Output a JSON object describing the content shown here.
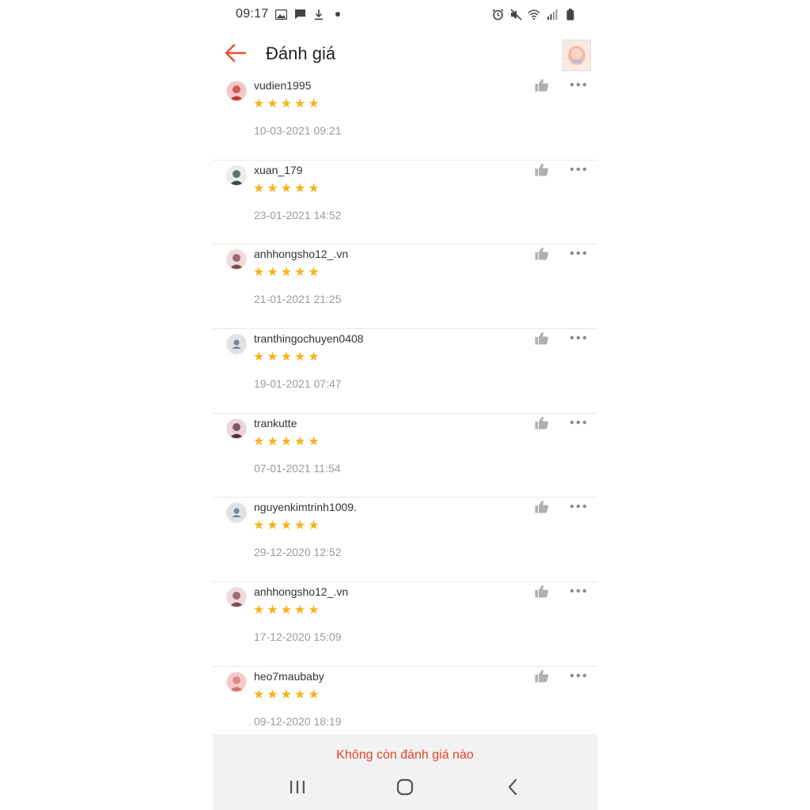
{
  "status_bar": {
    "time": "09:17",
    "left_icons": [
      "image-icon",
      "message-icon",
      "download-icon",
      "dot-icon"
    ],
    "right_icons": [
      "alarm-icon",
      "mute-icon",
      "wifi-icon",
      "signal-icon",
      "battery-icon"
    ]
  },
  "header": {
    "title": "Đánh giá",
    "back_icon": "arrow-left-icon",
    "accent_color": "#ee4d2d"
  },
  "reviews": [
    {
      "username": "vudien1995",
      "rating": 5,
      "date": "10-03-2021 09:21",
      "avatar": "photo"
    },
    {
      "username": "xuan_179",
      "rating": 5,
      "date": "23-01-2021 14:52",
      "avatar": "photo"
    },
    {
      "username": "anhhongsho12_.vn",
      "rating": 5,
      "date": "21-01-2021 21:25",
      "avatar": "photo"
    },
    {
      "username": "tranthingochuyen0408",
      "rating": 5,
      "date": "19-01-2021 07:47",
      "avatar": "default"
    },
    {
      "username": "trankutte",
      "rating": 5,
      "date": "07-01-2021 11:54",
      "avatar": "photo"
    },
    {
      "username": "nguyenkimtrinh1009.",
      "rating": 5,
      "date": "29-12-2020 12:52",
      "avatar": "default"
    },
    {
      "username": "anhhongsho12_.vn",
      "rating": 5,
      "date": "17-12-2020 15:09",
      "avatar": "photo"
    },
    {
      "username": "heo7maubaby",
      "rating": 5,
      "date": "09-12-2020 18:19",
      "avatar": "photo"
    }
  ],
  "footer": {
    "no_more_text": "Không còn đánh giá nào"
  },
  "nav": {
    "recents_icon": "recents-icon",
    "home_icon": "home-icon",
    "back_icon": "back-icon"
  },
  "colors": {
    "star": "#f6b31b",
    "accent": "#ee4d2d"
  }
}
